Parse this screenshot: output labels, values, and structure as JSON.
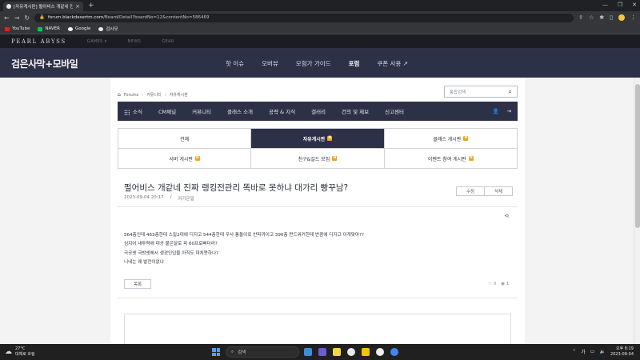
{
  "browser": {
    "tab_title": "[자유게시판] 펄어비스 개같네 진",
    "tab_close": "×",
    "new_tab": "+",
    "url_host": "forum.blackdesertm.com",
    "url_path": "/Board/Detail?boardNo=12&contentNo=586469",
    "nav_back": "←",
    "nav_forward": "→",
    "nav_reload": "↻",
    "window_controls": [
      "—",
      "❐",
      "✕"
    ],
    "bookmarks": [
      {
        "label": "YouTube",
        "color": "#e62117"
      },
      {
        "label": "NAVER",
        "color": "#03c75a"
      },
      {
        "label": "Google",
        "color": "#ffffff"
      },
      {
        "label": "검사모",
        "color": "#e8eaed"
      }
    ]
  },
  "site_top": {
    "logo": "PEARL ABYSS",
    "links": [
      "GAMES ▾",
      "NEWS",
      "GEAR"
    ]
  },
  "header": {
    "logo": "검은사막+모바일",
    "nav": [
      {
        "label": "핫 이슈",
        "active": false
      },
      {
        "label": "오버뷰",
        "active": false
      },
      {
        "label": "모험가 가이드",
        "active": false
      },
      {
        "label": "포럼",
        "active": true
      },
      {
        "label": "쿠폰 사용 ↗",
        "active": false
      }
    ]
  },
  "breadcrumb": {
    "items": [
      "Forums",
      "›",
      "커뮤니티",
      "›",
      "자유게시판"
    ]
  },
  "search": {
    "placeholder": "통합검색"
  },
  "sub_nav": {
    "items": [
      "소식",
      "CM채널",
      "커뮤니티",
      "클래스 소개",
      "공략 & 지식",
      "갤러리",
      "건의 및 제보",
      "신고센터"
    ]
  },
  "boards": [
    {
      "label": "전체",
      "active": false,
      "new": false
    },
    {
      "label": "자유게시판",
      "active": true,
      "new": true
    },
    {
      "label": "클래스 게시판",
      "active": false,
      "new": true
    },
    {
      "label": "서버 게시판",
      "active": false,
      "new": true
    },
    {
      "label": "친구&길드 모집",
      "active": false,
      "new": true
    },
    {
      "label": "이벤트 참여 게시판",
      "active": false,
      "new": true
    }
  ],
  "badge_new": "N",
  "post": {
    "title": "펄어비스 개같네 진짜 랭킹전관리 똑바로 못하냐 대가리 빵꾸남?",
    "date": "2023-09-04 20:17",
    "separator": "/",
    "author": "어기은일",
    "edit_label": "수정",
    "delete_label": "삭제",
    "body": [
      "564층인데 463층한테 스킬2대에 디지고 544층한테 우사 통돌이로 반피까이고 390층 펀드워커한테 반콤에 디지고 이게맞아??",
      "심지어 내투력에 대공 붙은달로 피 60프로빠더라?",
      "극공셋 극방셋해서 생겼인입을 아직도 대처못하나?",
      "니네는 왜 발전이없냐"
    ],
    "list_label": "목록",
    "likes": "0",
    "views": "1"
  },
  "taskbar": {
    "temperature": "27°C",
    "weather": "대체로 흐림",
    "search_label": "검색",
    "ime": "가",
    "time": "오후 8:19",
    "date": "2023-09-04",
    "app_colors": [
      "#3b8ed6",
      "#6c5bd4",
      "#f5d547",
      "#e8e8e8",
      "#f5c400",
      "#eeeeee",
      "#4285f4"
    ]
  },
  "colors": {
    "header_navy": "#2d3148",
    "badge_orange": "#f0a422"
  }
}
